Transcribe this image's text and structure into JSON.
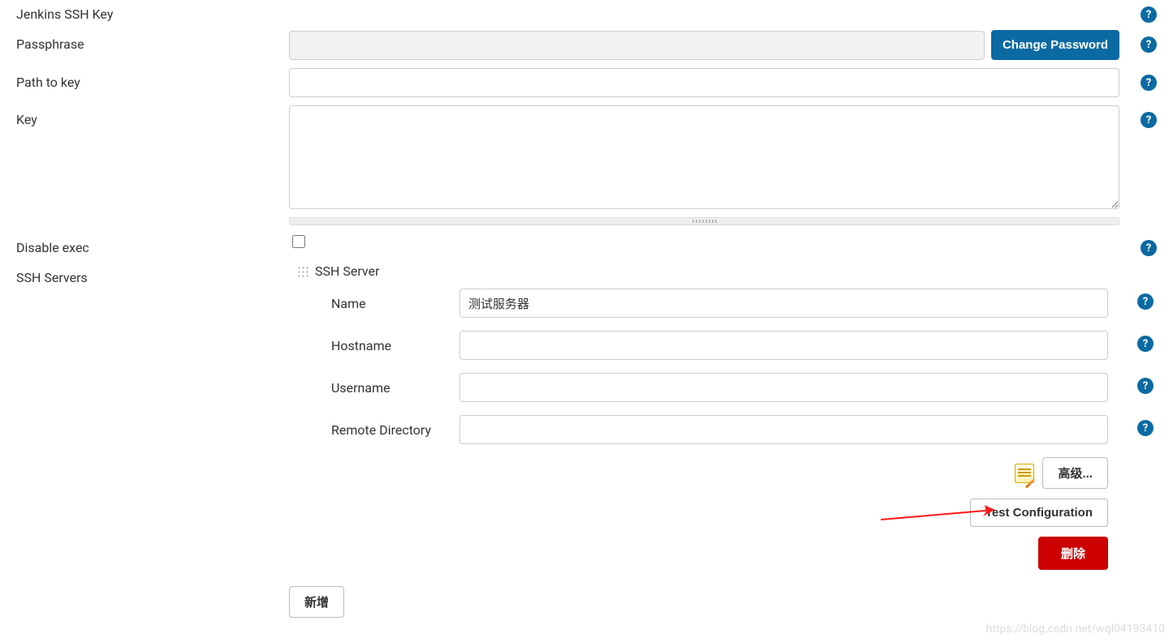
{
  "section_title": "Jenkins SSH Key",
  "labels": {
    "passphrase": "Passphrase",
    "path_to_key": "Path to key",
    "key": "Key",
    "disable_exec": "Disable exec",
    "ssh_servers": "SSH Servers"
  },
  "buttons": {
    "change_password": "Change Password",
    "advanced": "高级...",
    "test_configuration": "Test Configuration",
    "delete": "删除",
    "add": "新增"
  },
  "ssh_server": {
    "heading": "SSH Server",
    "labels": {
      "name": "Name",
      "hostname": "Hostname",
      "username": "Username",
      "remote_directory": "Remote Directory"
    },
    "values": {
      "name": "测试服务器",
      "hostname": "",
      "username": "",
      "remote_directory": ""
    }
  },
  "fields": {
    "passphrase_value": "",
    "path_to_key_value": "",
    "key_value": "",
    "disable_exec_checked": false
  },
  "watermark": "https://blog.csdn.net/wql04193410",
  "colors": {
    "primary": "#0b6aa2",
    "danger": "#cc0000"
  }
}
